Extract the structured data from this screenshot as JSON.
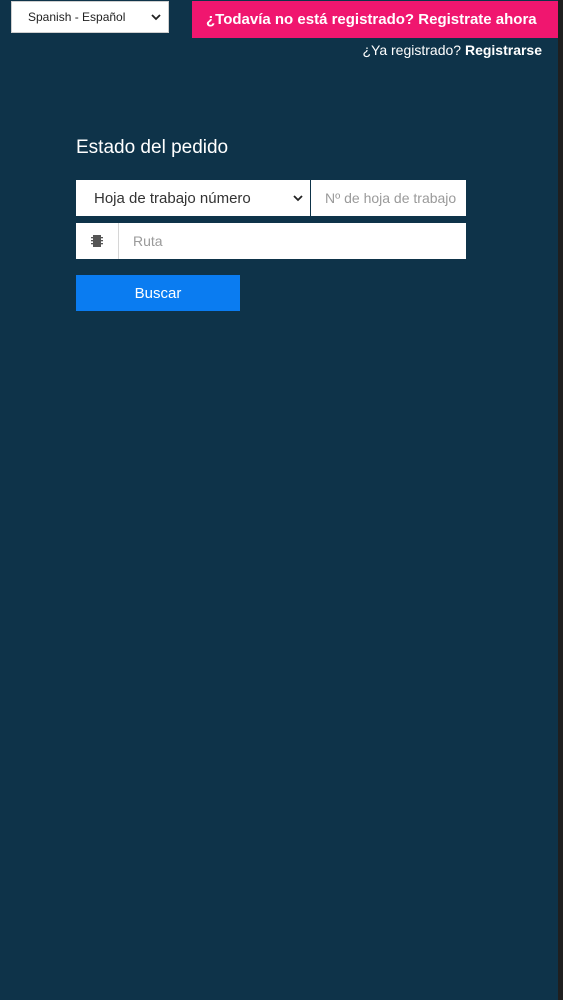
{
  "header": {
    "language": {
      "selected": "Spanish - Español",
      "icon": "chevron-down-icon"
    },
    "register_banner": "¿Todavía no está registrado? Registrate ahora",
    "login": {
      "prompt": "¿Ya registrado? ",
      "link": "Registrarse"
    }
  },
  "order_status": {
    "title": "Estado del pedido",
    "lookup_type": {
      "selected": "Hoja de trabajo número",
      "icon": "chevron-down-icon"
    },
    "number_input": {
      "value": "",
      "placeholder": "Nº de hoja de trabajo"
    },
    "route": {
      "icon": "chip-icon",
      "value": "",
      "placeholder": "Ruta"
    },
    "search_button": "Buscar"
  },
  "colors": {
    "background": "#0e3349",
    "banner": "#f0166f",
    "button": "#0a7cf1"
  }
}
